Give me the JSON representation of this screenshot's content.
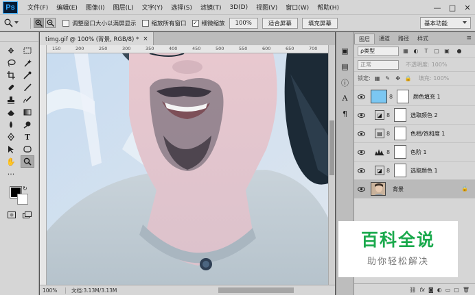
{
  "app": {
    "logo": "Ps"
  },
  "menu": [
    "文件(F)",
    "编辑(E)",
    "图像(I)",
    "图层(L)",
    "文字(Y)",
    "选择(S)",
    "滤镜(T)",
    "3D(D)",
    "视图(V)",
    "窗口(W)",
    "帮助(H)"
  ],
  "window_controls": {
    "minimize": "—",
    "maximize": "□",
    "close": "✕"
  },
  "options": {
    "resize_windows": "调整窗口大小以满屏显示",
    "zoom_all": "缩放所有窗口",
    "scrubby_zoom": "细微缩放",
    "zoom_value": "100%",
    "fit_screen": "适合屏幕",
    "fill_screen": "填充屏幕",
    "workspace": "基本功能"
  },
  "document": {
    "tab_title": "timg.gif @ 100% (背景, RGB/8) *",
    "close": "×",
    "ruler_ticks": [
      "150",
      "200",
      "250",
      "300",
      "350",
      "400",
      "450",
      "500",
      "550",
      "600",
      "650",
      "700"
    ]
  },
  "status": {
    "zoom": "100%",
    "doc_size": "文档:3.13M/3.13M"
  },
  "layers_panel": {
    "tabs": [
      "图层",
      "通道",
      "路径",
      "样式"
    ],
    "kind": "ρ类型",
    "blend_mode": "正常",
    "opacity_label": "不透明度:",
    "opacity_value": "100%",
    "lock_label": "锁定:",
    "fill_label": "填充:",
    "fill_value": "100%",
    "layers": [
      {
        "name": "颜色填充 1",
        "type": "fill"
      },
      {
        "name": "选取颜色 2",
        "type": "adjust"
      },
      {
        "name": "色相/饱和度 1",
        "type": "adjust"
      },
      {
        "name": "色阶 1",
        "type": "adjust"
      },
      {
        "name": "选取颜色 1",
        "type": "adjust"
      },
      {
        "name": "背景",
        "type": "background"
      }
    ],
    "bottom_icons": [
      "链接",
      "fx",
      "蒙版",
      "调整",
      "组",
      "新建",
      "删除"
    ]
  },
  "colors": {
    "fill_layer": "#7bc7f2",
    "accent_green": "#1aa94c"
  },
  "watermark": {
    "title": "百科全说",
    "subtitle": "助你轻松解决"
  }
}
